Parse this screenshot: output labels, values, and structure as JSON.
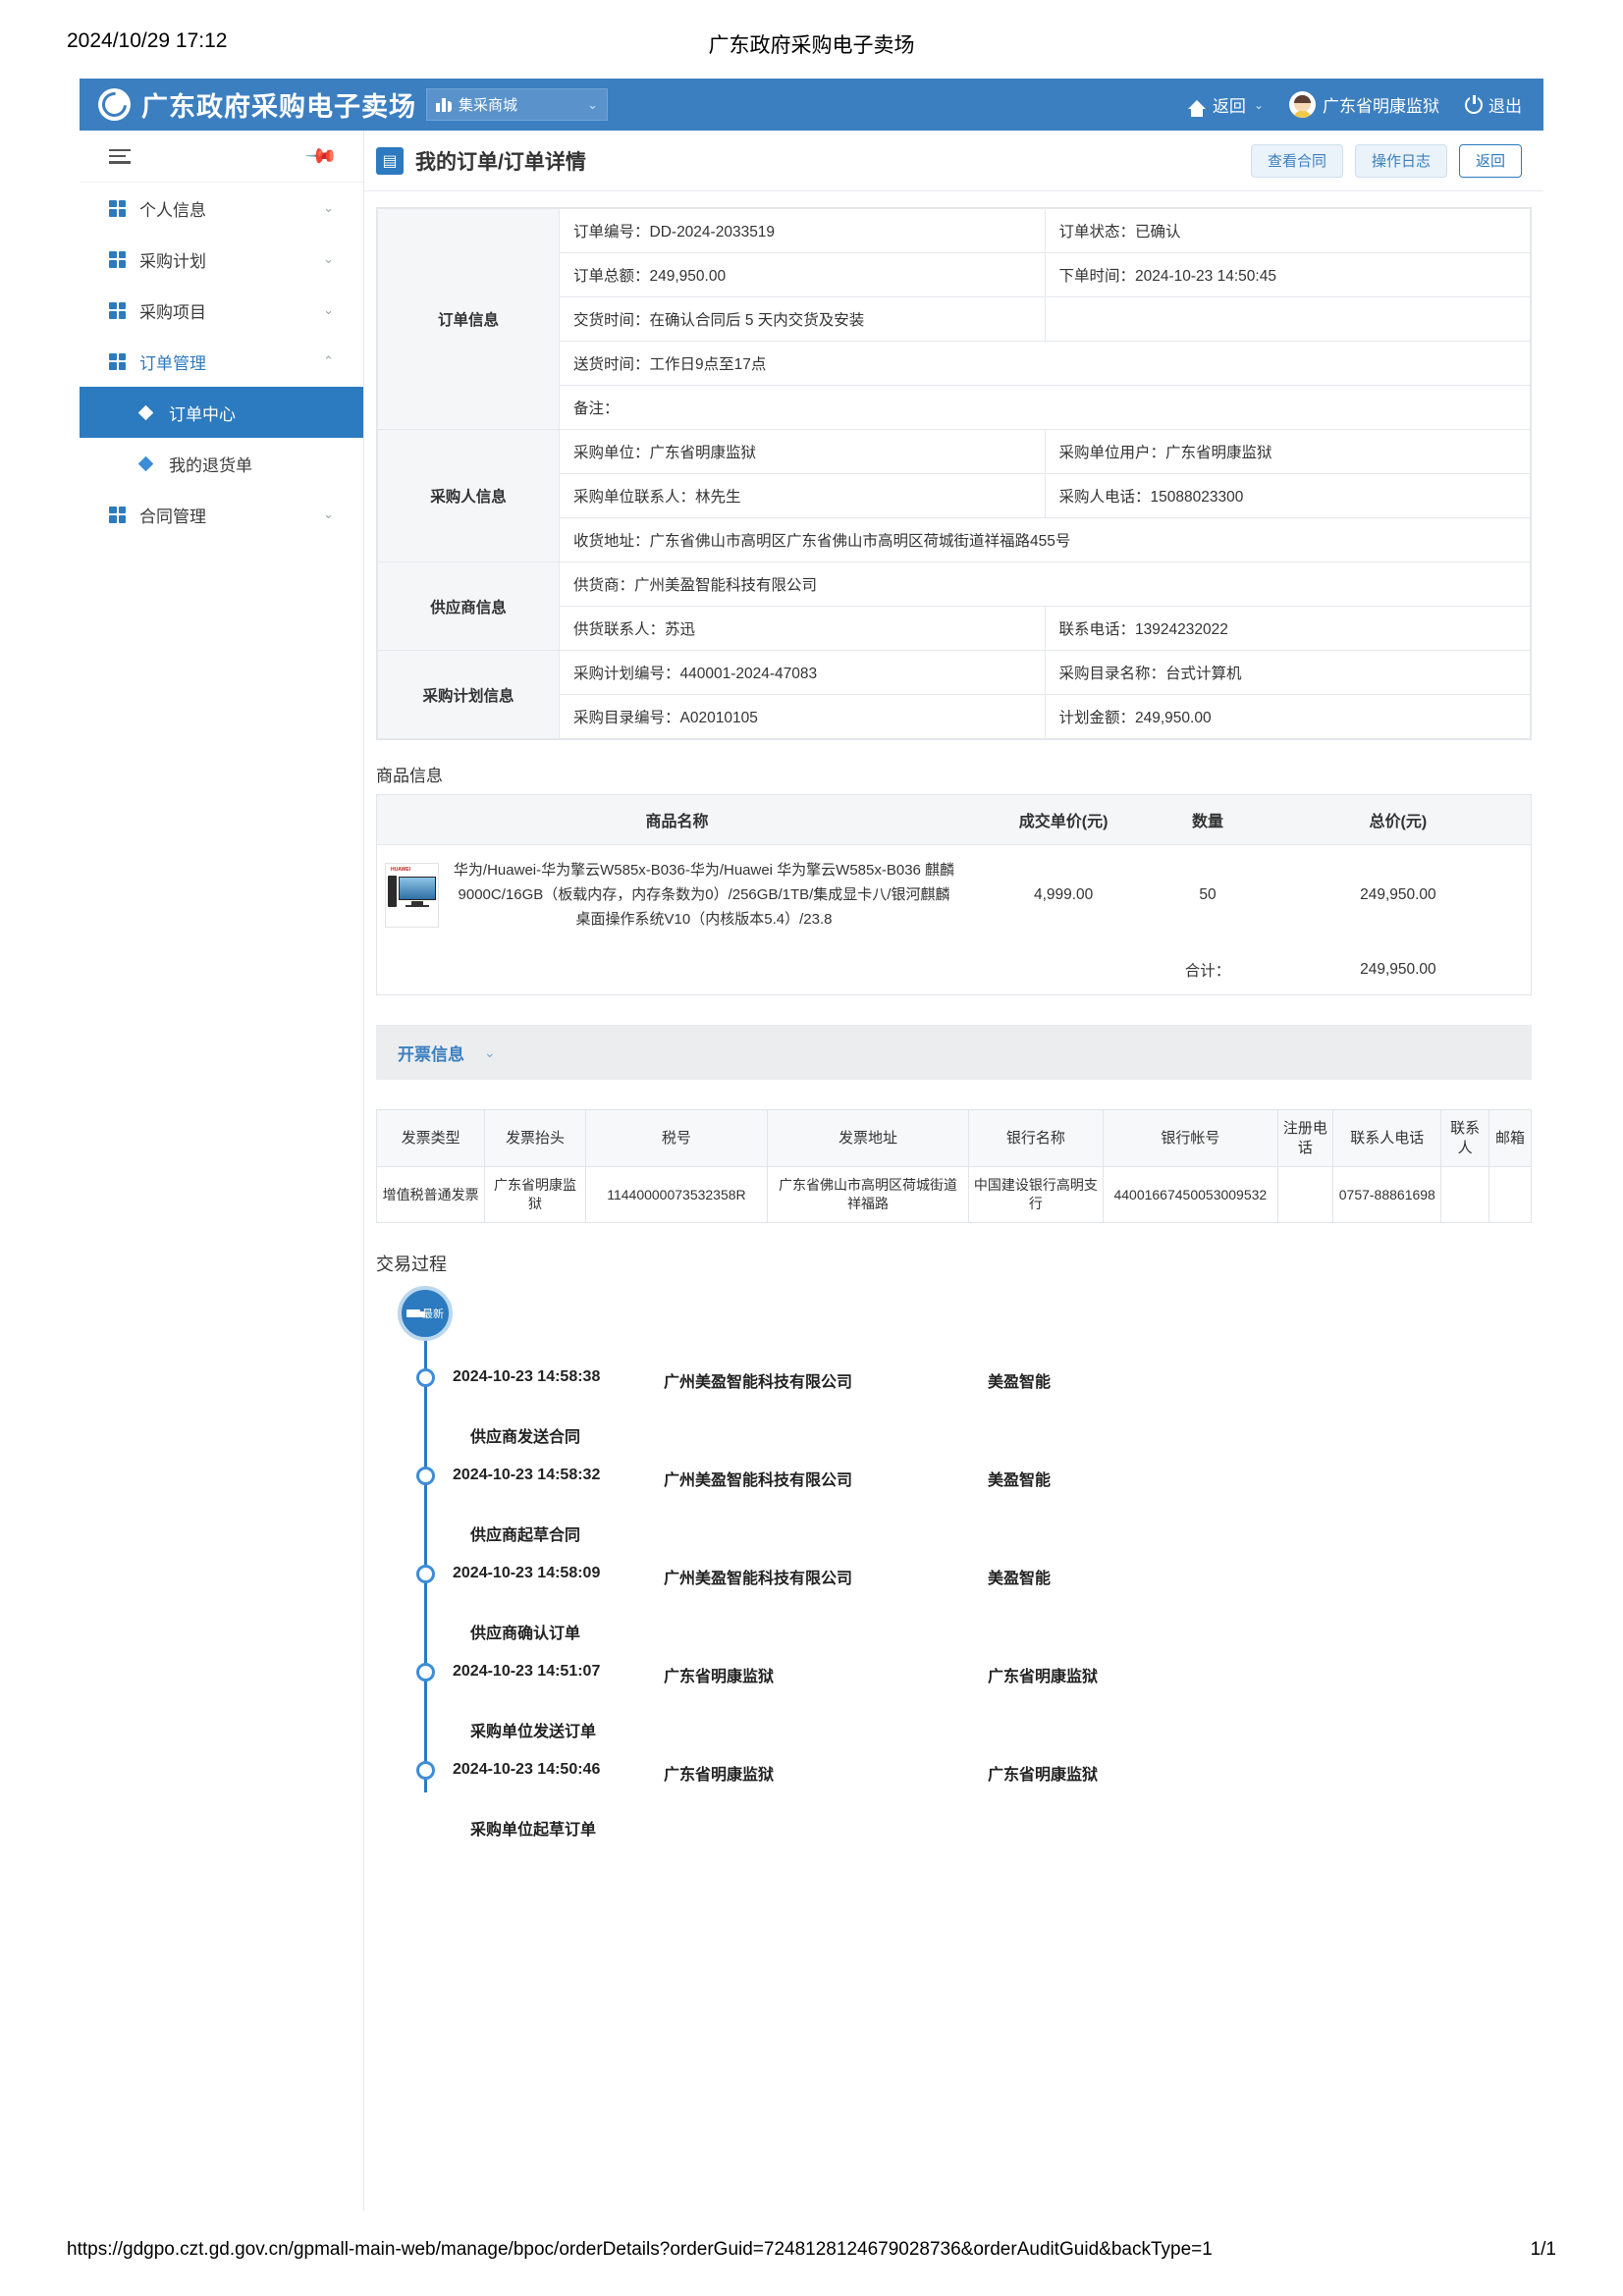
{
  "print": {
    "date": "2024/10/29 17:12",
    "title": "广东政府采购电子卖场",
    "url": "https://gdgpo.czt.gd.gov.cn/gpmall-main-web/manage/bpoc/orderDetails?orderGuid=7248128124679028736&orderAuditGuid&backType=1",
    "page": "1/1"
  },
  "topbar": {
    "brand": "广东政府采购电子卖场",
    "mall_selected": "集采商城",
    "back": "返回",
    "user": "广东省明康监狱",
    "logout": "退出"
  },
  "sidebar": {
    "items": [
      {
        "label": "个人信息"
      },
      {
        "label": "采购计划"
      },
      {
        "label": "采购项目"
      },
      {
        "label": "订单管理"
      },
      {
        "label": "合同管理"
      }
    ],
    "sub_items": [
      {
        "label": "订单中心"
      },
      {
        "label": "我的退货单"
      }
    ]
  },
  "page": {
    "title": "我的订单/订单详情",
    "buttons": {
      "view_contract": "查看合同",
      "operation_log": "操作日志",
      "back": "返回"
    }
  },
  "order_info": {
    "category": "订单信息",
    "order_no_label": "订单编号：",
    "order_no": "DD-2024-2033519",
    "status_label": "订单状态：",
    "status": "已确认",
    "total_label": "订单总额：",
    "total": "249,950.00",
    "order_time_label": "下单时间：",
    "order_time": "2024-10-23 14:50:45",
    "delivery_label": "交货时间：",
    "delivery": "在确认合同后 5 天内交货及安装",
    "ship_time_label": "送货时间：",
    "ship_time": "工作日9点至17点",
    "remark_label": "备注："
  },
  "buyer_info": {
    "category": "采购人信息",
    "unit_label": "采购单位：",
    "unit": "广东省明康监狱",
    "unit_user_label": "采购单位用户：",
    "unit_user": "广东省明康监狱",
    "contact_label": "采购单位联系人：",
    "contact": "林先生",
    "phone_label": "采购人电话：",
    "phone": "15088023300",
    "address_label": "收货地址：",
    "address": "广东省佛山市高明区广东省佛山市高明区荷城街道祥福路455号"
  },
  "supplier_info": {
    "category": "供应商信息",
    "supplier_label": "供货商：",
    "supplier": "广州美盈智能科技有限公司",
    "contact_label": "供货联系人：",
    "contact": "苏迅",
    "phone_label": "联系电话：",
    "phone": "13924232022"
  },
  "plan_info": {
    "category": "采购计划信息",
    "plan_no_label": "采购计划编号：",
    "plan_no": "440001-2024-47083",
    "catalog_name_label": "采购目录名称：",
    "catalog_name": "台式计算机",
    "catalog_no_label": "采购目录编号：",
    "catalog_no": "A02010105",
    "plan_amount_label": "计划金额：",
    "plan_amount": "249,950.00"
  },
  "goods": {
    "section_title": "商品信息",
    "headers": {
      "name": "商品名称",
      "price": "成交单价(元)",
      "qty": "数量",
      "total": "总价(元)"
    },
    "rows": [
      {
        "name": "华为/Huawei-华为擎云W585x-B036-华为/Huawei 华为擎云W585x-B036 麒麟9000C/16GB（板载内存，内存条数为0）/256GB/1TB/集成显卡八/银河麒麟桌面操作系统V10（内核版本5.4）/23.8",
        "price": "4,999.00",
        "qty": "50",
        "total": "249,950.00"
      }
    ],
    "sum_label": "合计：",
    "sum_value": "249,950.00"
  },
  "invoice": {
    "bar_label": "开票信息",
    "headers": [
      "发票类型",
      "发票抬头",
      "税号",
      "发票地址",
      "银行名称",
      "银行帐号",
      "注册电话",
      "联系人电话",
      "联系人",
      "邮箱"
    ],
    "rows": [
      {
        "type": "增值税普通发票",
        "title": "广东省明康监狱",
        "tax_no": "11440000073532358R",
        "address": "广东省佛山市高明区荷城街道祥福路",
        "bank_name": "中国建设银行高明支行",
        "bank_account": "44001667450053009532",
        "reg_phone": "",
        "contact_phone": "0757-88861698",
        "contact": "",
        "email": ""
      }
    ]
  },
  "timeline": {
    "section_title": "交易过程",
    "badge": "最新",
    "rows": [
      {
        "time": "2024-10-23 14:58:38",
        "org": "广州美盈智能科技有限公司",
        "short": "美盈智能",
        "action": "供应商发送合同"
      },
      {
        "time": "2024-10-23 14:58:32",
        "org": "广州美盈智能科技有限公司",
        "short": "美盈智能",
        "action": "供应商起草合同"
      },
      {
        "time": "2024-10-23 14:58:09",
        "org": "广州美盈智能科技有限公司",
        "short": "美盈智能",
        "action": "供应商确认订单"
      },
      {
        "time": "2024-10-23 14:51:07",
        "org": "广东省明康监狱",
        "short": "广东省明康监狱",
        "action": "采购单位发送订单"
      },
      {
        "time": "2024-10-23 14:50:46",
        "org": "广东省明康监狱",
        "short": "广东省明康监狱",
        "action": "采购单位起草订单"
      }
    ]
  },
  "colors": {
    "brand_blue": "#3C7FC0",
    "accent": "#2C7ABF"
  }
}
